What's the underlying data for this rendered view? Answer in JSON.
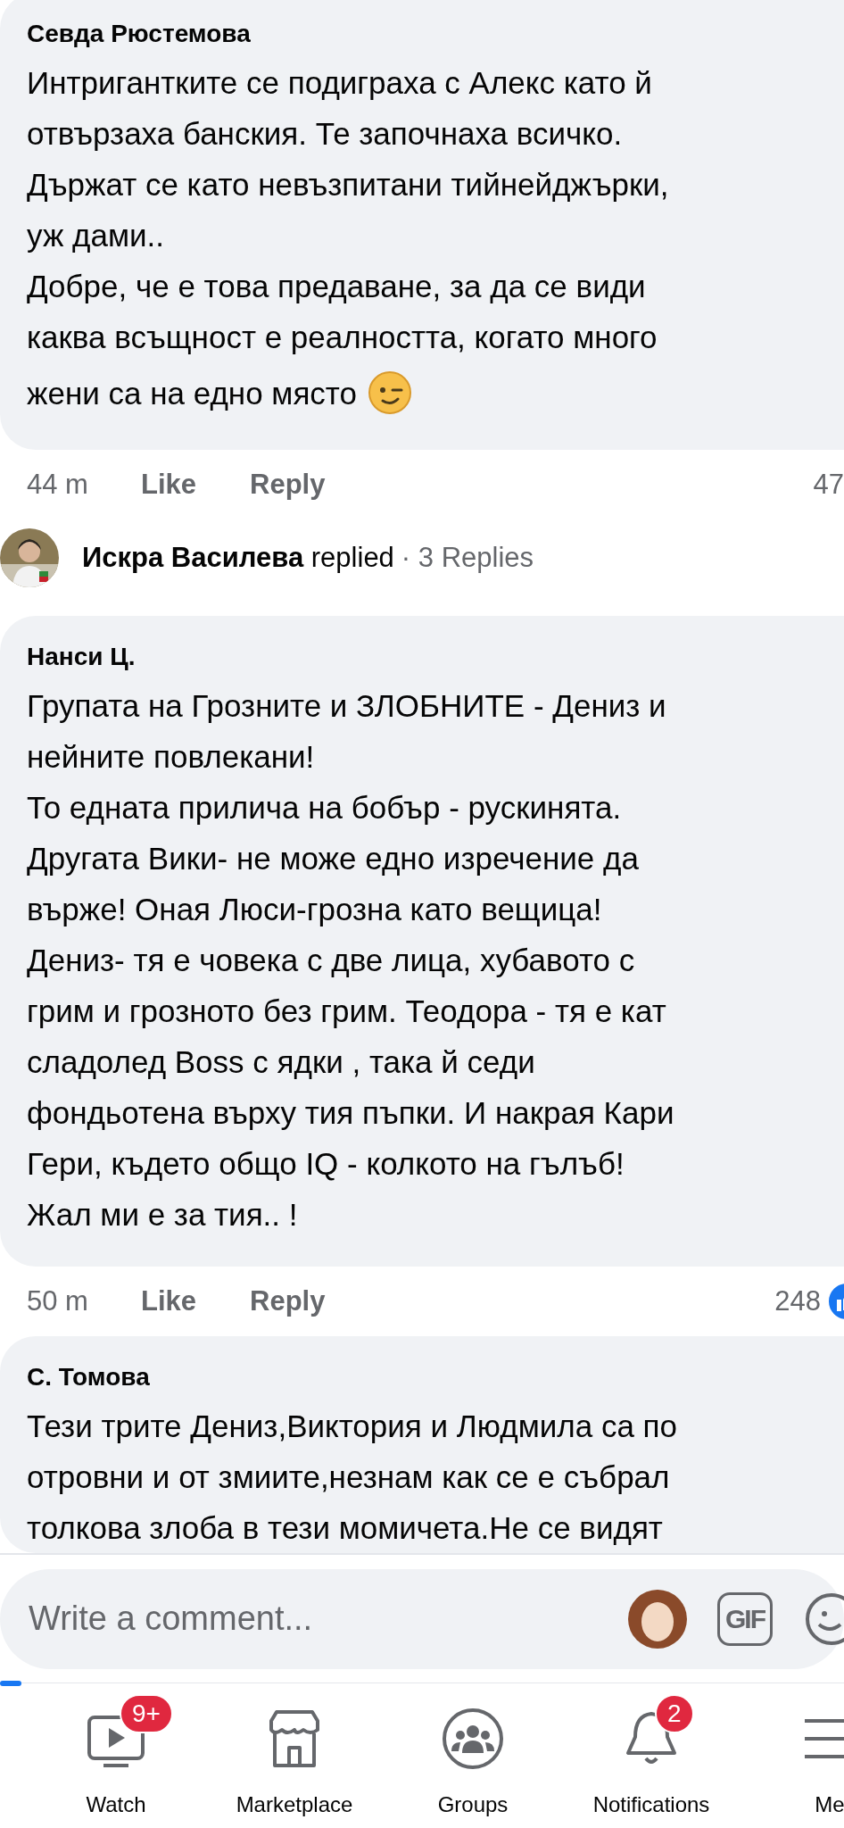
{
  "thread": [
    {
      "kind": "emoji_comment",
      "author": "Севда Рюстемова",
      "body": "Интригантките се подиграха с Алекс като й\nотвързаха банския. Те започнаха всичко.\nДържат се като невъзпитани тийнейджърки,\nуж дами..\nДобре, че е това предаване, за да се види\nкаква всъщност е реалността, когато много",
      "last_line": "жени са на едно място",
      "time": "44 m",
      "actions": [
        "Like",
        "Reply"
      ],
      "reactions": "47"
    },
    {
      "kind": "replies",
      "author": "Искра Василева",
      "verb": "replied",
      "count": "· 3 Replies"
    },
    {
      "kind": "comment",
      "author": "Нанси Ц.",
      "body": "Групата на Грозните и ЗЛОБНИТЕ - Дениз и\nнейните повлекани!\nТо едната прилича на бобър - рускинята.\nДругата Вики- не може едно изречение да\nвърже! Оная Люси-грозна като вещица!\nДениз- тя е човека с две лица, хубавото с\nгрим и грозното без грим. Теодора - тя е кат\nсладолед Boss с ядки , така й седи\nфондьотена върху тия пъпки. И накрая Кари\nГери, където общо IQ - колкото на гълъб!\nЖал ми е за тия.. !",
      "time": "50 m",
      "actions": [
        "Like",
        "Reply"
      ],
      "reactions": "248",
      "reaction_icon": true
    },
    {
      "kind": "comment",
      "author": "С. Томова",
      "body": "Тези трите Дениз,Виктория и Людмила са по\nотровни и от змиите,незнам как се е събрал\nтолкова злоба в тези момичета.Не се видят"
    }
  ],
  "composer": {
    "placeholder": "Write a comment...",
    "gif": "GIF"
  },
  "nav": [
    {
      "label": "Watch",
      "badge": "9+"
    },
    {
      "label": "Marketplace"
    },
    {
      "label": "Groups"
    },
    {
      "label": "Notifications",
      "badge": "2"
    },
    {
      "label": "Me"
    }
  ]
}
